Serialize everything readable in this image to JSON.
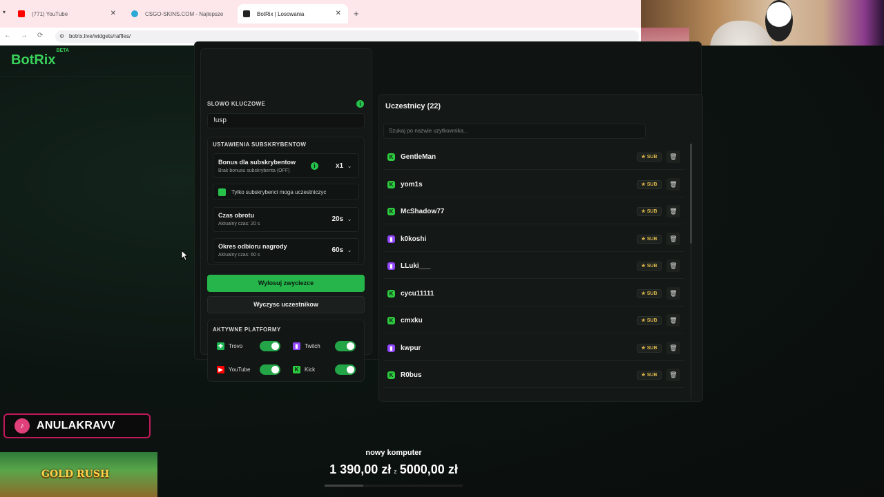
{
  "browser": {
    "tabs": [
      {
        "title": "(771) YouTube",
        "color": "#ff0000"
      },
      {
        "title": "CSGO-SKINS.COM - Najlepsze",
        "color": "#2aa9d6"
      },
      {
        "title": "BotRix | Losowania",
        "color": "#222222"
      }
    ],
    "url": "botrix.live/widgets/raffles/"
  },
  "app": {
    "logo": "BotRix",
    "logo_badge": "BETA",
    "accent": "#27c24c"
  },
  "settings": {
    "keyword_label": "SLOWO KLUCZOWE",
    "keyword_value": "!usp",
    "sub_section_label": "USTAWIENIA SUBSKRYBENTOW",
    "bonus_title": "Bonus dla subskrybentow",
    "bonus_sub": "Brak bonusu subskrybenta (OFF)",
    "bonus_value": "x1",
    "only_subs": "Tylko subskrybenci moga uczestniczyc",
    "spin_title": "Czas obrotu",
    "spin_sub": "Aktualny czas: 20 s",
    "spin_value": "20s",
    "claim_title": "Okres odbioru nagrody",
    "claim_sub": "Aktualny czas: 60 s",
    "claim_value": "60s",
    "draw_button": "Wylosuj zwyciezce",
    "clear_button": "Wyczysc uczestnikow",
    "platforms_label": "AKTYWNE PLATFORMY",
    "platforms": [
      {
        "name": "Trovo",
        "color": "#1db954"
      },
      {
        "name": "Twitch",
        "color": "#9146ff"
      },
      {
        "name": "YouTube",
        "color": "#ff0000"
      },
      {
        "name": "Kick",
        "color": "#2ecc40"
      }
    ]
  },
  "participants": {
    "title": "Uczestnicy (22)",
    "search_placeholder": "Szukaj po nazwie uzytkownika...",
    "badge": "SUB",
    "items": [
      {
        "name": "GentleMan",
        "platform": "kick"
      },
      {
        "name": "yom1s",
        "platform": "kick"
      },
      {
        "name": "McShadow77",
        "platform": "kick"
      },
      {
        "name": "k0koshi",
        "platform": "twitch"
      },
      {
        "name": "LLuki___",
        "platform": "twitch"
      },
      {
        "name": "cycu11111",
        "platform": "kick"
      },
      {
        "name": "cmxku",
        "platform": "kick"
      },
      {
        "name": "kwpur",
        "platform": "twitch"
      },
      {
        "name": "R0bus",
        "platform": "kick"
      }
    ]
  },
  "overlay": {
    "tiktok_name": "ANULAKRAVV",
    "game_name": "GOLD RUSH",
    "goal_title": "nowy komputer",
    "goal_current": "1 390,00 zł",
    "goal_target": "5000,00 zł",
    "goal_progress": 0.278
  }
}
